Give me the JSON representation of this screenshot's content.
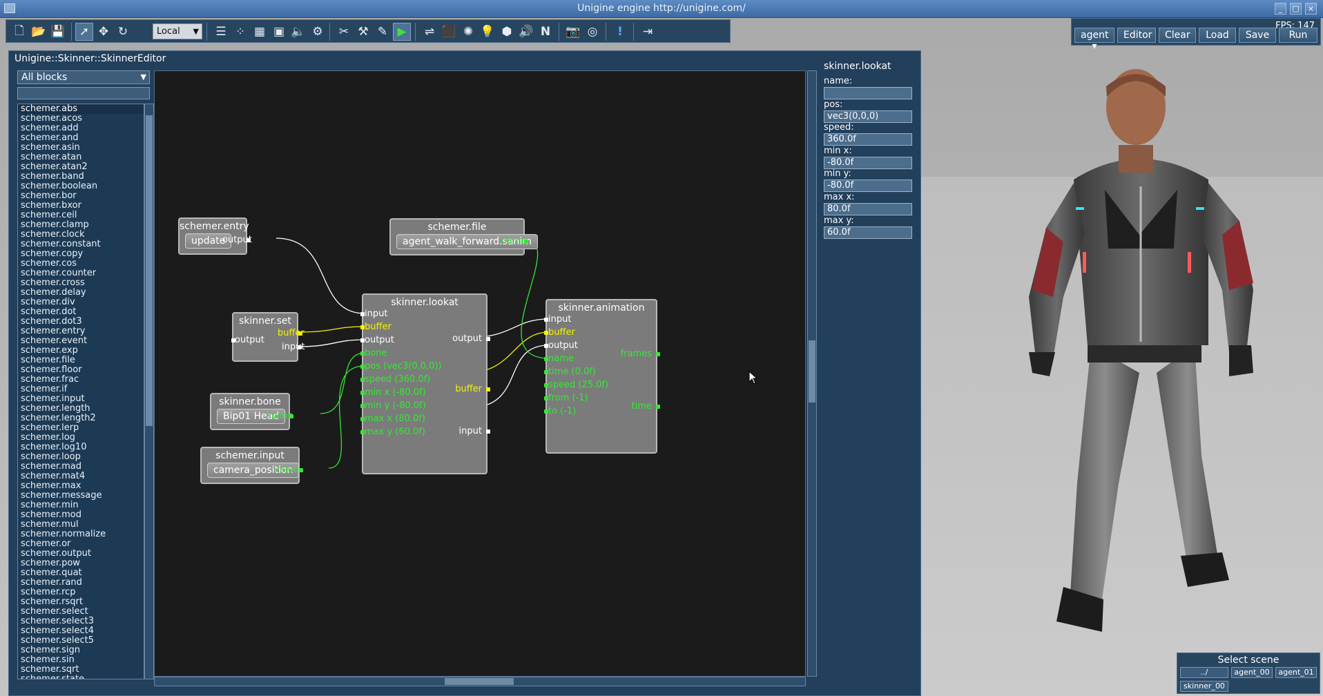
{
  "window": {
    "title": "Unigine engine http://unigine.com/"
  },
  "toolbar": {
    "coordinate_space": "Local"
  },
  "scene_panel": {
    "fps": "FPS: 147",
    "agent_select": "agent",
    "editor": "Editor",
    "clear": "Clear",
    "load": "Load",
    "save": "Save",
    "run": "Run"
  },
  "editor": {
    "title": "Unigine::Skinner::SkinnerEditor",
    "filter": "All blocks",
    "blocks": [
      "schemer.abs",
      "schemer.acos",
      "schemer.add",
      "schemer.and",
      "schemer.asin",
      "schemer.atan",
      "schemer.atan2",
      "schemer.band",
      "schemer.boolean",
      "schemer.bor",
      "schemer.bxor",
      "schemer.ceil",
      "schemer.clamp",
      "schemer.clock",
      "schemer.constant",
      "schemer.copy",
      "schemer.cos",
      "schemer.counter",
      "schemer.cross",
      "schemer.delay",
      "schemer.div",
      "schemer.dot",
      "schemer.dot3",
      "schemer.entry",
      "schemer.event",
      "schemer.exp",
      "schemer.file",
      "schemer.floor",
      "schemer.frac",
      "schemer.if",
      "schemer.input",
      "schemer.length",
      "schemer.length2",
      "schemer.lerp",
      "schemer.log",
      "schemer.log10",
      "schemer.loop",
      "schemer.mad",
      "schemer.mat4",
      "schemer.max",
      "schemer.message",
      "schemer.min",
      "schemer.mod",
      "schemer.mul",
      "schemer.normalize",
      "schemer.or",
      "schemer.output",
      "schemer.pow",
      "schemer.quat",
      "schemer.rand",
      "schemer.rcp",
      "schemer.rsqrt",
      "schemer.select",
      "schemer.select3",
      "schemer.select4",
      "schemer.select5",
      "schemer.sign",
      "schemer.sin",
      "schemer.sqrt",
      "schemer.state"
    ]
  },
  "nodes": {
    "entry": {
      "title": "schemer.entry",
      "button": "update",
      "output": "output"
    },
    "file": {
      "title": "schemer.file",
      "button": "agent_walk_forward.sanim",
      "name": "name"
    },
    "set": {
      "title": "skinner.set",
      "output": "output",
      "buffer": "buffer",
      "input": "input"
    },
    "bone": {
      "title": "skinner.bone",
      "button": "Bip01 Head",
      "name": "name"
    },
    "input": {
      "title": "schemer.input",
      "button": "camera_position",
      "value": "value"
    },
    "lookat": {
      "title": "skinner.lookat",
      "inputs": [
        "input",
        "buffer",
        "output",
        "bone",
        "pos (vec3(0,0,0))",
        "speed (360.0f)",
        "min x (-80.0f)",
        "min y (-80.0f)",
        "max x (80.0f)",
        "max y (60.0f)"
      ],
      "output": "output",
      "buffer": "buffer",
      "input": "input"
    },
    "animation": {
      "title": "skinner.animation",
      "inputs": [
        "input",
        "buffer",
        "output",
        "name",
        "time (0.0f)",
        "speed (25.0f)",
        "from (-1)",
        "to (-1)"
      ],
      "frames": "frames",
      "time": "time"
    }
  },
  "properties": {
    "title": "skinner.lookat",
    "fields": [
      {
        "label": "name:",
        "value": ""
      },
      {
        "label": "pos:",
        "value": "vec3(0,0,0)"
      },
      {
        "label": "speed:",
        "value": "360.0f"
      },
      {
        "label": "min x:",
        "value": "-80.0f"
      },
      {
        "label": "min y:",
        "value": "-80.0f"
      },
      {
        "label": "max x:",
        "value": "80.0f"
      },
      {
        "label": "max y:",
        "value": "60.0f"
      }
    ]
  },
  "select_scene": {
    "title": "Select scene",
    "items": [
      "../",
      "agent_00",
      "agent_01",
      "skinner_00"
    ]
  }
}
